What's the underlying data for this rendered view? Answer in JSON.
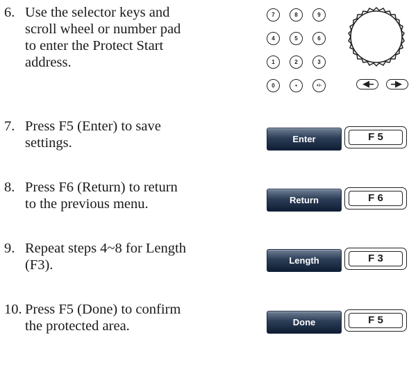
{
  "steps": [
    {
      "num": "6.",
      "lines": [
        "Use the selector keys and",
        "scroll wheel or number pad",
        "to enter the Protect Start",
        "address."
      ]
    },
    {
      "num": "7.",
      "lines": [
        "Press F5 (Enter) to save",
        "settings."
      ]
    },
    {
      "num": "8.",
      "lines": [
        "Press F6 (Return) to return",
        "to the previous menu."
      ]
    },
    {
      "num": "9.",
      "lines": [
        "Repeat steps 4~8 for Length",
        "(F3)."
      ]
    },
    {
      "num": "10.",
      "lines": [
        "Press F5 (Done) to confirm",
        "the protected area."
      ]
    }
  ],
  "keypad": {
    "keys": [
      "7",
      "8",
      "9",
      "4",
      "5",
      "6",
      "1",
      "2",
      "3",
      "0",
      "•",
      "+/-"
    ]
  },
  "buttons": [
    {
      "soft_label": "Enter",
      "fkey_label": "F 5"
    },
    {
      "soft_label": "Return",
      "fkey_label": "F 6"
    },
    {
      "soft_label": "Length",
      "fkey_label": "F 3"
    },
    {
      "soft_label": "Done",
      "fkey_label": "F 5"
    }
  ],
  "icons": [
    "scroll-wheel-icon",
    "left-arrow-key-icon",
    "right-arrow-key-icon"
  ]
}
